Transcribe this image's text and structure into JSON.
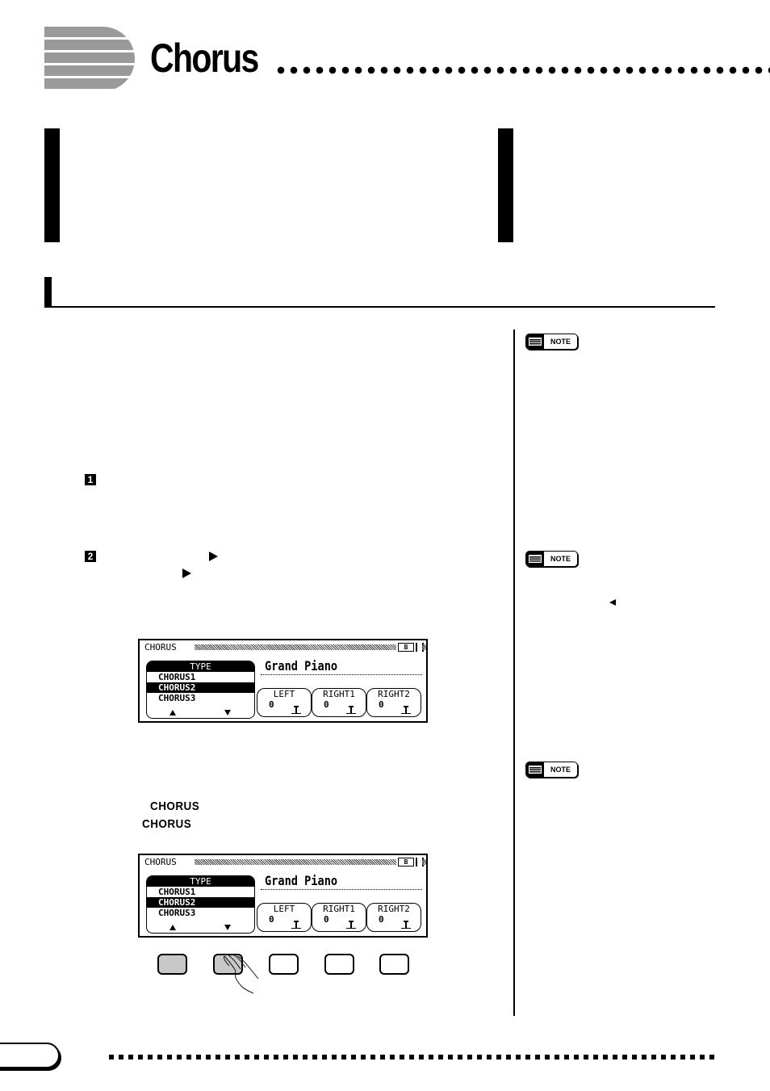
{
  "header": {
    "title": "Chorus"
  },
  "steps": [
    {
      "number": "1"
    },
    {
      "number": "2"
    }
  ],
  "notes": [
    {
      "label": "NOTE"
    },
    {
      "label": "NOTE"
    },
    {
      "label": "NOTE"
    }
  ],
  "inline_labels": {
    "chorus_1": "CHORUS",
    "chorus_2": "CHORUS"
  },
  "lcd_displays": [
    {
      "screen_label": "CHORUS",
      "page_indicator": "B",
      "type_header": "TYPE",
      "type_options": [
        "CHORUS1",
        "CHORUS2",
        "CHORUS3"
      ],
      "selected_type": "CHORUS2",
      "voice_name": "Grand Piano",
      "volumes": [
        {
          "label": "LEFT",
          "value": "0"
        },
        {
          "label": "RIGHT1",
          "value": "0"
        },
        {
          "label": "RIGHT2",
          "value": "0"
        }
      ]
    },
    {
      "screen_label": "CHORUS",
      "page_indicator": "B",
      "type_header": "TYPE",
      "type_options": [
        "CHORUS1",
        "CHORUS2",
        "CHORUS3"
      ],
      "selected_type": "CHORUS2",
      "voice_name": "Grand Piano",
      "volumes": [
        {
          "label": "LEFT",
          "value": "0"
        },
        {
          "label": "RIGHT1",
          "value": "0"
        },
        {
          "label": "RIGHT2",
          "value": "0"
        }
      ]
    }
  ],
  "panel_buttons": [
    {
      "state": "lit"
    },
    {
      "state": "lit-pressed"
    },
    {
      "state": "off"
    },
    {
      "state": "off"
    },
    {
      "state": "off"
    }
  ]
}
